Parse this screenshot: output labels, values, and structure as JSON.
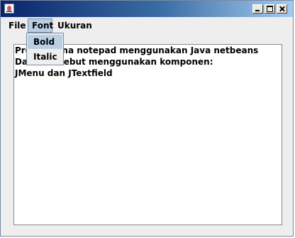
{
  "menubar": {
    "items": [
      "File",
      "Font",
      "Ukuran"
    ]
  },
  "font_menu": {
    "items": [
      "Bold",
      "Italic"
    ]
  },
  "editor": {
    "lines": [
      "Pro     derhana notepad menggunakan Java netbeans",
      "Dal       si tersebut menggunakan komponen:",
      "JMenu dan JTextfield"
    ]
  }
}
